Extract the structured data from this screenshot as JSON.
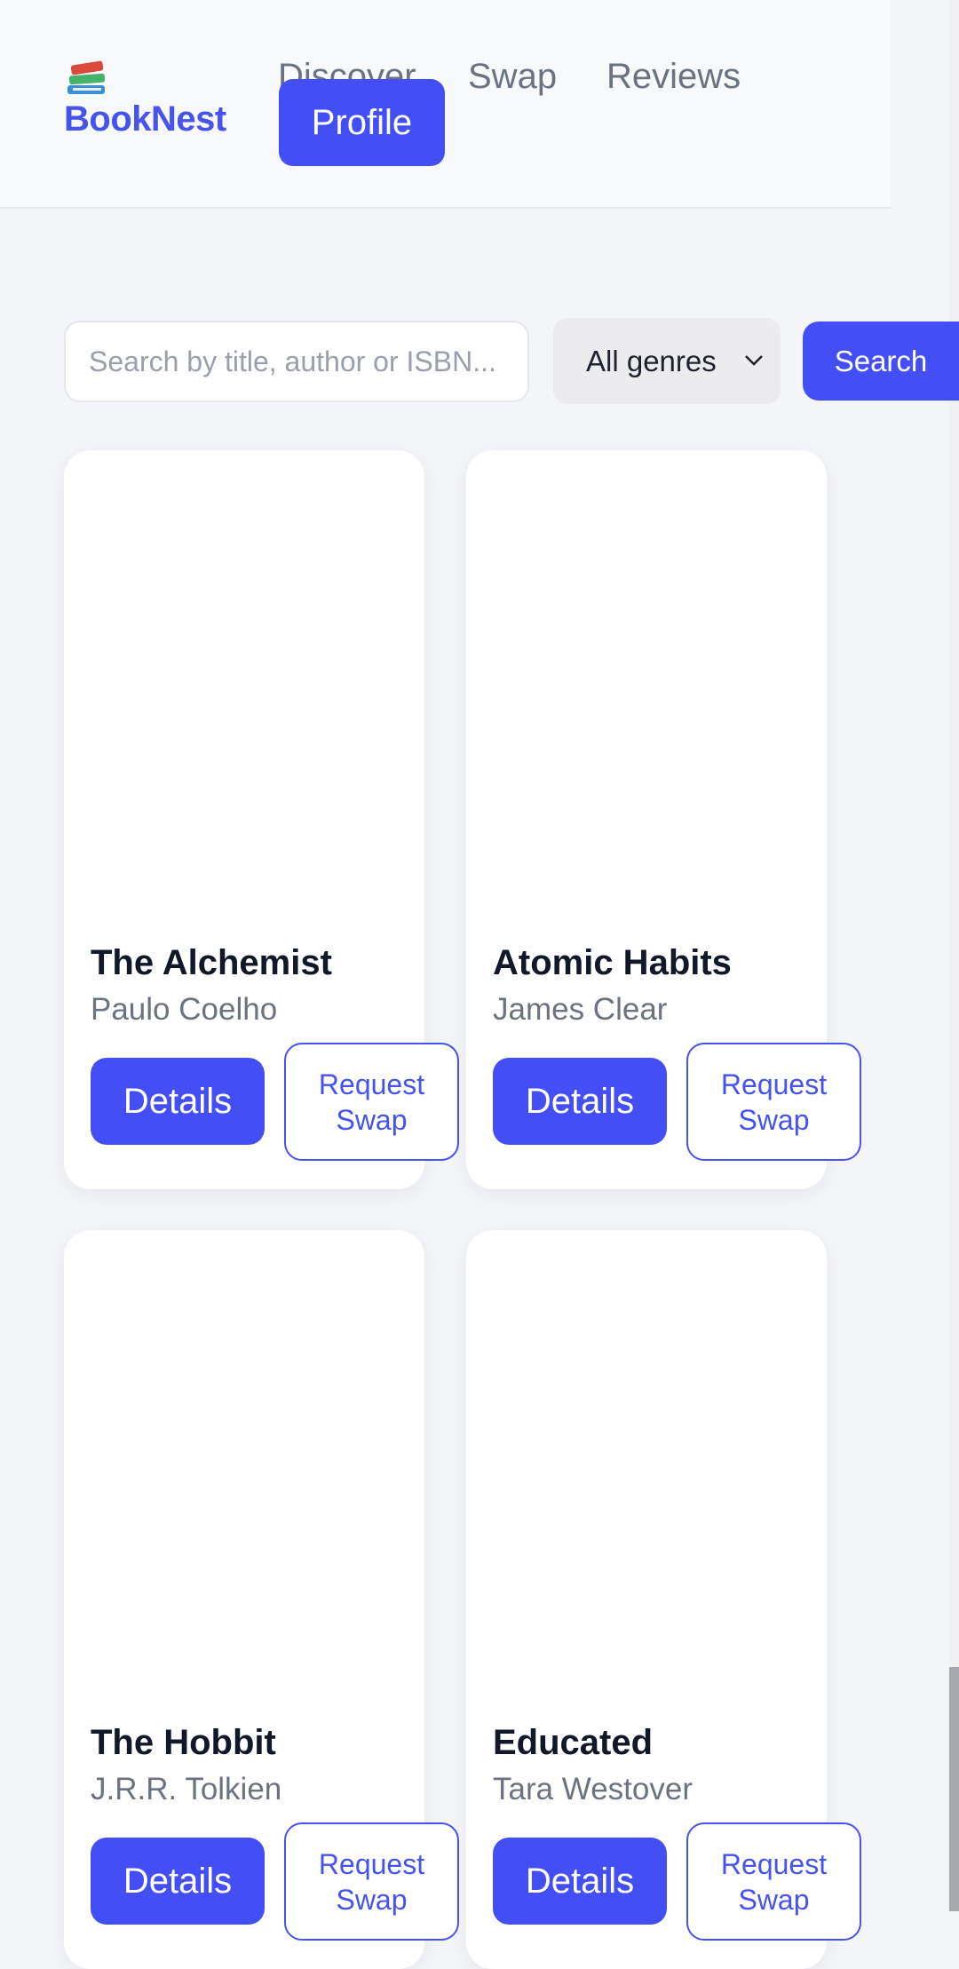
{
  "app": {
    "name": "BookNest",
    "logo_icon": "books-stack-icon",
    "brand_color": "#4653ef"
  },
  "nav": {
    "discover": "Discover",
    "swap": "Swap",
    "reviews": "Reviews",
    "profile": "Profile"
  },
  "search": {
    "placeholder": "Search by title, author or ISBN...",
    "genre_selected": "All genres",
    "button": "Search"
  },
  "books": [
    {
      "title": "The Alchemist",
      "author": "Paulo Coelho",
      "details": "Details",
      "swap": "Request Swap"
    },
    {
      "title": "Atomic Habits",
      "author": "James Clear",
      "details": "Details",
      "swap": "Request Swap"
    },
    {
      "title": "The Hobbit",
      "author": "J.R.R. Tolkien",
      "details": "Details",
      "swap": "Request Swap"
    },
    {
      "title": "Educated",
      "author": "Tara Westover",
      "details": "Details",
      "swap": "Request Swap"
    }
  ]
}
